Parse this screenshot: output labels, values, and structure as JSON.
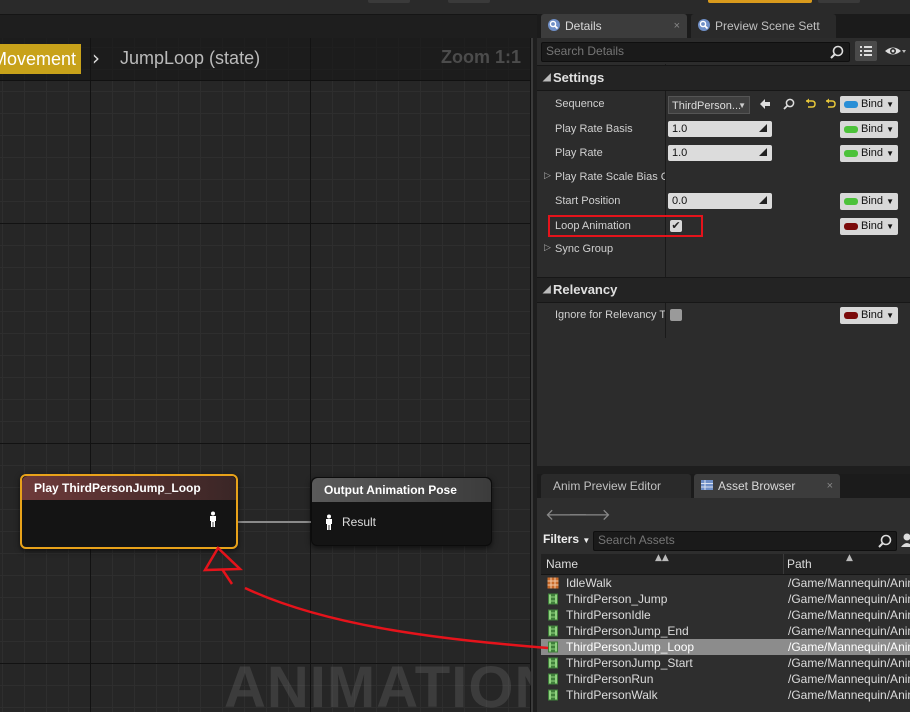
{
  "graph": {
    "breadcrumb_parent": "Movement",
    "breadcrumb_separator": "›",
    "breadcrumb_current": "JumpLoop (state)",
    "zoom": "Zoom 1:1",
    "watermark": "ANIMATION",
    "play_node": {
      "title": "Play ThirdPersonJump_Loop",
      "pin_icon": "pose-pin-icon"
    },
    "output_node": {
      "title": "Output Animation Pose",
      "pin_label": "Result",
      "pin_icon": "pose-pin-icon"
    }
  },
  "details": {
    "tabs": [
      {
        "label": "Details",
        "icon": "search-icon",
        "close": "×"
      },
      {
        "label": "Preview Scene Sett",
        "icon": "search-icon"
      }
    ],
    "search_placeholder": "Search Details",
    "categories": {
      "settings": "Settings",
      "relevancy": "Relevancy"
    },
    "properties": {
      "sequence": {
        "label": "Sequence",
        "value": "ThirdPerson...",
        "bind": "Bind",
        "bind_color": "#2a8fd6"
      },
      "play_rate_basis": {
        "label": "Play Rate Basis",
        "value": "1.0",
        "bind": "Bind",
        "bind_color": "#4cc23a"
      },
      "play_rate": {
        "label": "Play Rate",
        "value": "1.0",
        "bind": "Bind",
        "bind_color": "#4cc23a"
      },
      "play_rate_scale_bias": {
        "label": "Play Rate Scale Bias C"
      },
      "start_position": {
        "label": "Start Position",
        "value": "0.0",
        "bind": "Bind",
        "bind_color": "#4cc23a"
      },
      "loop_animation": {
        "label": "Loop Animation",
        "checked": true,
        "check_mark": "✔",
        "bind": "Bind",
        "bind_color": "#7a0a0a"
      },
      "sync_group": {
        "label": "Sync Group"
      },
      "ignore_relevancy": {
        "label": "Ignore for Relevancy T",
        "checked": false,
        "bind": "Bind",
        "bind_color": "#7a0a0a"
      }
    }
  },
  "assets": {
    "tabs": [
      {
        "label": "Anim Preview Editor"
      },
      {
        "label": "Asset Browser",
        "icon": "asset-grid-icon",
        "close": "×"
      }
    ],
    "back": "🡐",
    "forward": "🡒",
    "filters_label": "Filters",
    "search_placeholder": "Search Assets",
    "columns": {
      "name": "Name",
      "path": "Path"
    },
    "rows": [
      {
        "name": "IdleWalk",
        "path": "/Game/Mannequin/Animations",
        "icon": "blendspace-icon",
        "selected": false
      },
      {
        "name": "ThirdPerson_Jump",
        "path": "/Game/Mannequin/Animations",
        "icon": "anim-sequence-icon",
        "selected": false
      },
      {
        "name": "ThirdPersonIdle",
        "path": "/Game/Mannequin/Animations",
        "icon": "anim-sequence-icon",
        "selected": false
      },
      {
        "name": "ThirdPersonJump_End",
        "path": "/Game/Mannequin/Animations",
        "icon": "anim-sequence-icon",
        "selected": false
      },
      {
        "name": "ThirdPersonJump_Loop",
        "path": "/Game/Mannequin/Animations",
        "icon": "anim-sequence-icon",
        "selected": true
      },
      {
        "name": "ThirdPersonJump_Start",
        "path": "/Game/Mannequin/Animations",
        "icon": "anim-sequence-icon",
        "selected": false
      },
      {
        "name": "ThirdPersonRun",
        "path": "/Game/Mannequin/Animations",
        "icon": "anim-sequence-icon",
        "selected": false
      },
      {
        "name": "ThirdPersonWalk",
        "path": "/Game/Mannequin/Animations",
        "icon": "anim-sequence-icon",
        "selected": false
      }
    ]
  },
  "annotation": {
    "color": "#e5131b"
  }
}
